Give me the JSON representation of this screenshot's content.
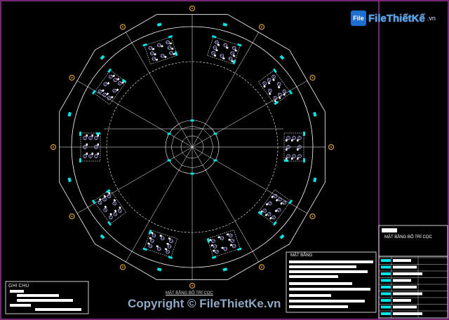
{
  "logo": {
    "icon_text": "File",
    "brand": "FileThiếtKế",
    "suffix": ".vn"
  },
  "plan_title": "MẶT BẰNG BỐ TRÍ CỌC",
  "notes_title": "GHI CHÚ",
  "sheet_title": "MẶT BẰNG BỐ TRÍ CỌC",
  "legend_title": "MẶT BẰNG",
  "watermark": "Copyright © FileThietKe.vn",
  "colors": {
    "background": "#000000",
    "frame": "#c040c0",
    "lines": "#ffffff",
    "cyan_marks": "#00e5e5",
    "grid_marker": "#d89a3a",
    "pile": "#b8b8ff"
  },
  "icons": [
    "grid-bubble-icon",
    "pile-cross-icon"
  ]
}
